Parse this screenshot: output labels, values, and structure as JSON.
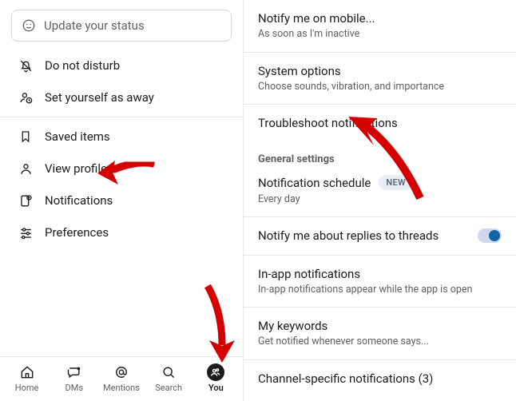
{
  "status": {
    "placeholder": "Update your status"
  },
  "menu": {
    "dnd": "Do not disturb",
    "away": "Set yourself as away",
    "saved": "Saved items",
    "profile": "View profile",
    "notifications": "Notifications",
    "preferences": "Preferences"
  },
  "tabs": {
    "home": "Home",
    "dms": "DMs",
    "mentions": "Mentions",
    "search": "Search",
    "you": "You"
  },
  "settings": {
    "mobile": {
      "title": "Notify me on mobile...",
      "sub": "As soon as I'm inactive"
    },
    "system": {
      "title": "System options",
      "sub": "Choose sounds, vibration, and importance"
    },
    "troubleshoot": {
      "title": "Troubleshoot notifications"
    },
    "general_head": "General settings",
    "schedule": {
      "label": "Notification schedule",
      "badge": "NEW",
      "sub": "Every day"
    },
    "threads": {
      "title": "Notify me about replies to threads"
    },
    "inapp": {
      "title": "In-app notifications",
      "sub": "In-app notifications appear while the app is open"
    },
    "keywords": {
      "title": "My keywords",
      "sub": "Get notified whenever someone says..."
    },
    "channel": {
      "title": "Channel-specific notifications (3)"
    }
  }
}
